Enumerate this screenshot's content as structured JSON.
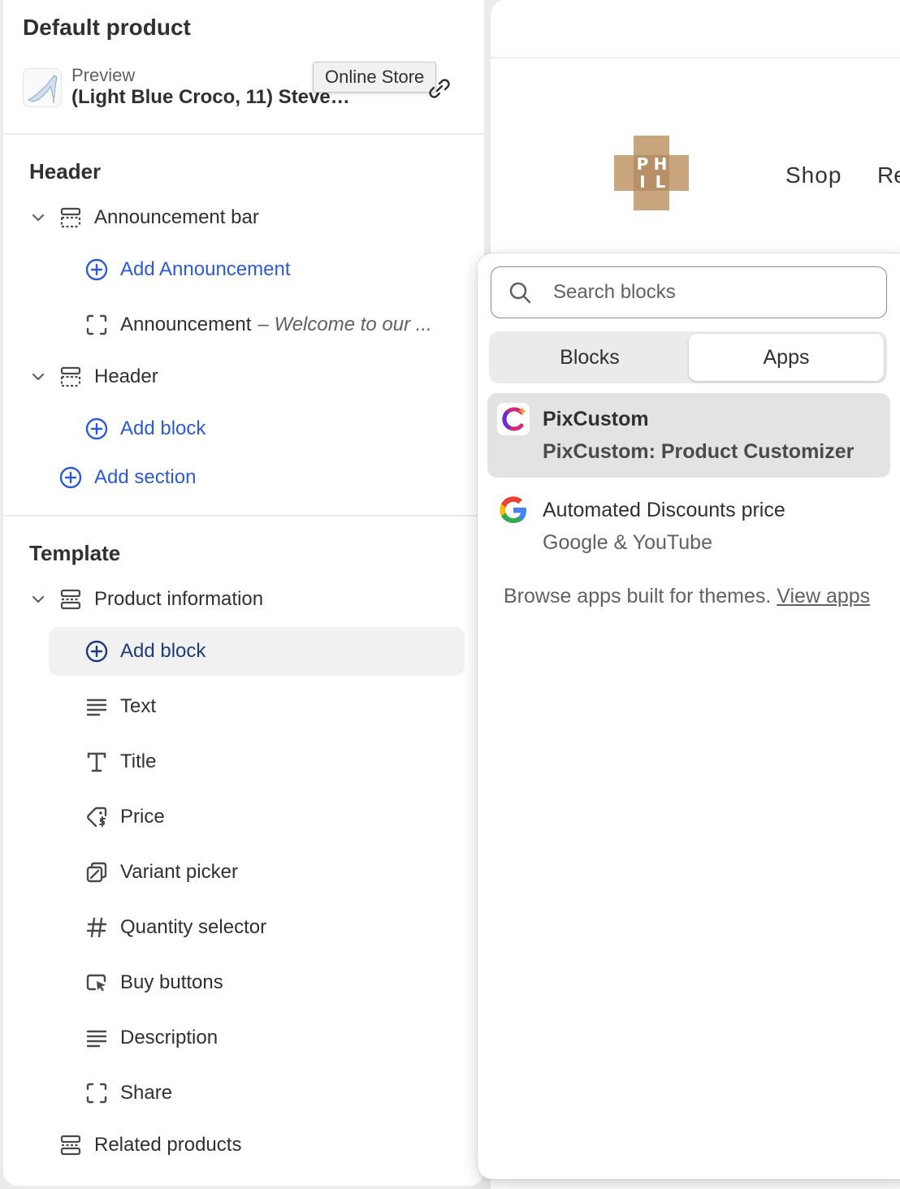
{
  "sidebar": {
    "title": "Default product",
    "preview": {
      "label": "Preview",
      "value": "(Light Blue Croco, 11) Steve ...",
      "tooltip": "Online Store"
    },
    "header_section": {
      "heading": "Header",
      "items": [
        {
          "label": "Announcement bar"
        },
        {
          "label": "Add Announcement"
        },
        {
          "label": "Announcement",
          "detail": "– Welcome to our ..."
        },
        {
          "label": "Header"
        },
        {
          "label": "Add block"
        },
        {
          "label": "Add section"
        }
      ]
    },
    "template_section": {
      "heading": "Template",
      "items": [
        {
          "label": "Product information"
        },
        {
          "label": "Add block"
        },
        {
          "label": "Text"
        },
        {
          "label": "Title"
        },
        {
          "label": "Price"
        },
        {
          "label": "Variant picker"
        },
        {
          "label": "Quantity selector"
        },
        {
          "label": "Buy buttons"
        },
        {
          "label": "Description"
        },
        {
          "label": "Share"
        },
        {
          "label": "Related products"
        }
      ]
    }
  },
  "storefront": {
    "logo_letters": [
      "P",
      "H",
      "I",
      "L"
    ],
    "nav": [
      "Shop",
      "Re"
    ]
  },
  "popover": {
    "search_placeholder": "Search blocks",
    "tabs": [
      "Blocks",
      "Apps"
    ],
    "active_tab": "Apps",
    "apps": [
      {
        "name": "PixCustom",
        "subtitle": "PixCustom: Product Customizer"
      },
      {
        "name": "Automated Discounts price",
        "subtitle": "Google & YouTube"
      }
    ],
    "browse_text": "Browse apps built for themes.",
    "browse_link": "View apps"
  },
  "colors": {
    "link_blue": "#2c5bd5",
    "text": "#303030",
    "muted": "#616161",
    "highlight": "#f1f1f1",
    "selected": "#e3e3e3"
  }
}
